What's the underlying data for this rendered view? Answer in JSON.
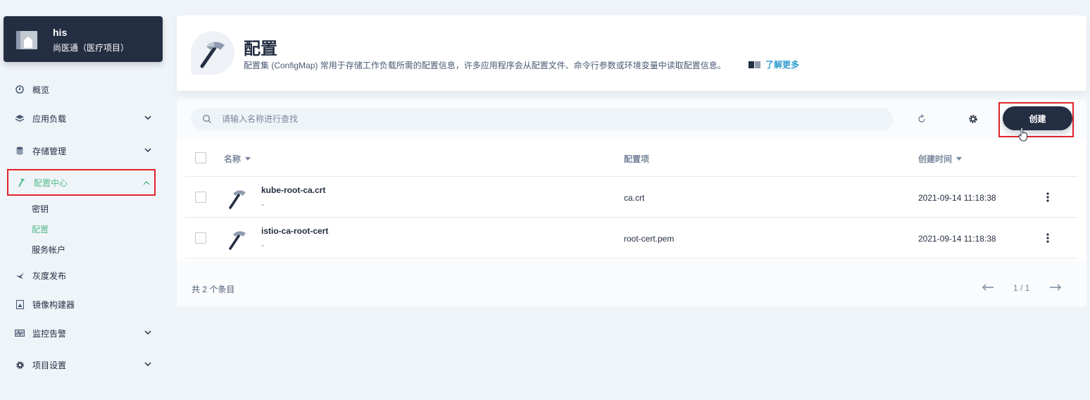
{
  "project": {
    "name": "his",
    "description": "尚医通（医疗项目）"
  },
  "sidebar": {
    "items": [
      {
        "label": "概览",
        "icon": "dashboard-icon"
      },
      {
        "label": "应用负载",
        "icon": "stack-icon",
        "expandable": true
      },
      {
        "label": "存储管理",
        "icon": "database-icon",
        "expandable": true
      },
      {
        "label": "配置中心",
        "icon": "hammer-icon",
        "expandable": true,
        "expanded": true,
        "active": true
      },
      {
        "label": "灰度发布",
        "icon": "bird-icon"
      },
      {
        "label": "镜像构建器",
        "icon": "image-builder-icon"
      },
      {
        "label": "监控告警",
        "icon": "monitor-icon",
        "expandable": true
      },
      {
        "label": "项目设置",
        "icon": "gear-icon",
        "expandable": true
      }
    ],
    "config_sub": [
      {
        "label": "密钥",
        "active": false
      },
      {
        "label": "配置",
        "active": true
      },
      {
        "label": "服务帐户",
        "active": false
      }
    ]
  },
  "header": {
    "title": "配置",
    "description": "配置集 (ConfigMap) 常用于存储工作负载所需的配置信息，许多应用程序会从配置文件、命令行参数或环境变量中读取配置信息。",
    "learn_more": "了解更多"
  },
  "toolbar": {
    "search_placeholder": "请输入名称进行查找",
    "create_label": "创建"
  },
  "table": {
    "columns": [
      "名称",
      "配置项",
      "创建时间"
    ],
    "rows": [
      {
        "name": "kube-root-ca.crt",
        "sub": "-",
        "config": "ca.crt",
        "created": "2021-09-14 11:18:38"
      },
      {
        "name": "istio-ca-root-cert",
        "sub": "-",
        "config": "root-cert.pem",
        "created": "2021-09-14 11:18:38"
      }
    ]
  },
  "footer": {
    "total": "共 2 个条目",
    "page": "1 / 1"
  },
  "colors": {
    "dark": "#242e42",
    "accent_green": "#55bc8a",
    "link_blue": "#329dce",
    "highlight_red": "#e0242a",
    "page_bg": "#eff4f9"
  }
}
